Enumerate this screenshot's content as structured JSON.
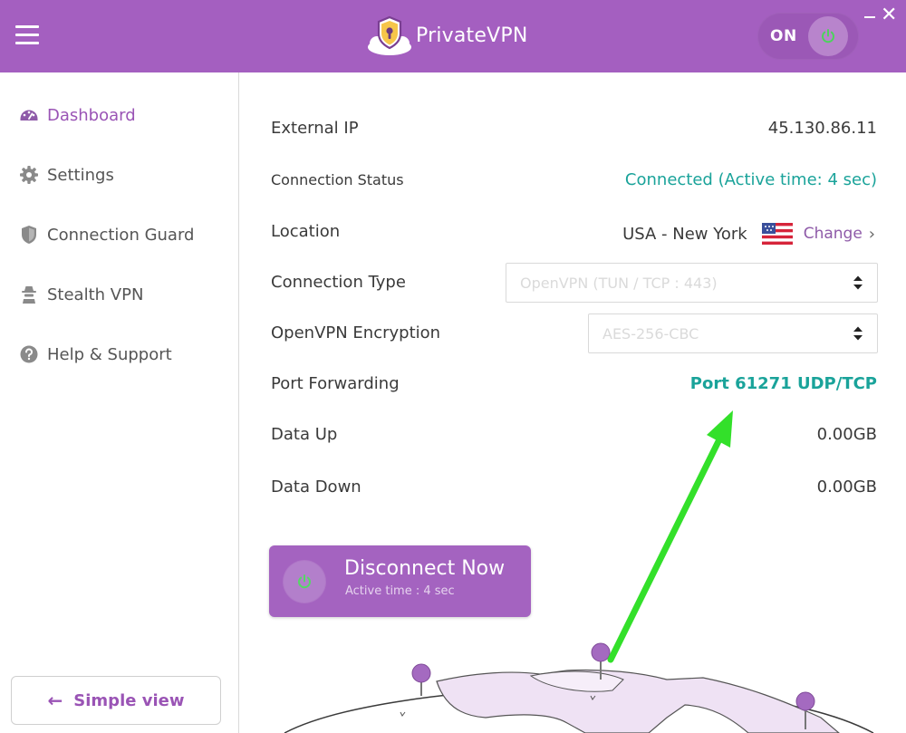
{
  "header": {
    "brand": "PrivateVPN",
    "toggle_label": "ON",
    "close_glyph": "✕",
    "icons": {
      "menu": "hamburger-menu-icon",
      "logo": "shield-keyhole-icon",
      "power": "power-icon"
    }
  },
  "sidebar": {
    "items": [
      {
        "label": "Dashboard",
        "icon": "dashboard-gauge-icon",
        "active": true
      },
      {
        "label": "Settings",
        "icon": "gear-icon",
        "active": false
      },
      {
        "label": "Connection Guard",
        "icon": "shield-icon",
        "active": false
      },
      {
        "label": "Stealth VPN",
        "icon": "spy-icon",
        "active": false
      },
      {
        "label": "Help & Support",
        "icon": "question-circle-icon",
        "active": false
      }
    ],
    "simple_view_label": "Simple view",
    "simple_view_arrow": "←"
  },
  "main": {
    "external_ip": {
      "label": "External IP",
      "value": "45.130.86.11"
    },
    "connection_status": {
      "label": "Connection Status",
      "value": "Connected  (Active time:  4 sec)"
    },
    "location": {
      "label": "Location",
      "value": "USA - New York",
      "change_label": "Change",
      "chevron": "›",
      "flag_icon": "us-flag-icon"
    },
    "connection_type": {
      "label": "Connection Type",
      "selected": "OpenVPN (TUN / TCP : 443)"
    },
    "encryption": {
      "label": "OpenVPN Encryption",
      "selected": "AES-256-CBC"
    },
    "port_forwarding": {
      "label": "Port Forwarding",
      "value": "Port 61271 UDP/TCP"
    },
    "data_up": {
      "label": "Data Up",
      "value": "0.00GB"
    },
    "data_down": {
      "label": "Data Down",
      "value": "0.00GB"
    },
    "disconnect": {
      "title": "Disconnect Now",
      "subtitle": "Active time :  4 sec"
    }
  },
  "colors": {
    "brand_purple": "#a45fc0",
    "accent_teal": "#1aa39a",
    "annotation_green": "#33e02a",
    "map_fill": "#efe2f4",
    "pin": "#a46ac0"
  }
}
